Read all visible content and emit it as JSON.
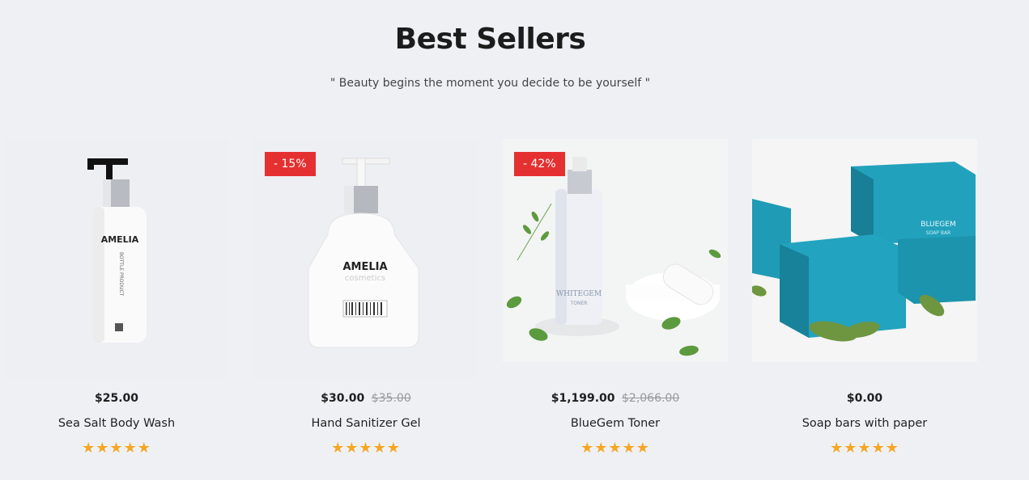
{
  "section": {
    "title": "Best Sellers",
    "subtitle": "\" Beauty begins the moment you decide to be yourself \""
  },
  "products": [
    {
      "name": "Sea Salt Body Wash",
      "price": "$25.00",
      "old_price": "",
      "badge": "",
      "rating_stars": "★★★★★",
      "rating": 5,
      "image_brand": "AMELIA",
      "image_line": "BOTTLE PRODUCT"
    },
    {
      "name": "Hand Sanitizer Gel",
      "price": "$30.00",
      "old_price": "$35.00",
      "badge": "- 15%",
      "rating_stars": "★★★★★",
      "rating": 5,
      "image_brand": "AMELIA",
      "image_line": "cosmetics"
    },
    {
      "name": "BlueGem Toner",
      "price": "$1,199.00",
      "old_price": "$2,066.00",
      "badge": "- 42%",
      "rating_stars": "★★★★★",
      "rating": 5,
      "image_brand": "WHITEGEM",
      "image_line": "TONER"
    },
    {
      "name": "Soap bars with paper",
      "price": "$0.00",
      "old_price": "",
      "badge": "",
      "rating_stars": "★★★★★",
      "rating": 5,
      "image_brand": "BLUEGEM",
      "image_line": "SOAP BAR"
    }
  ],
  "colors": {
    "badge": "#e43030",
    "star": "#f5a623",
    "soap": "#1f9bb5"
  }
}
